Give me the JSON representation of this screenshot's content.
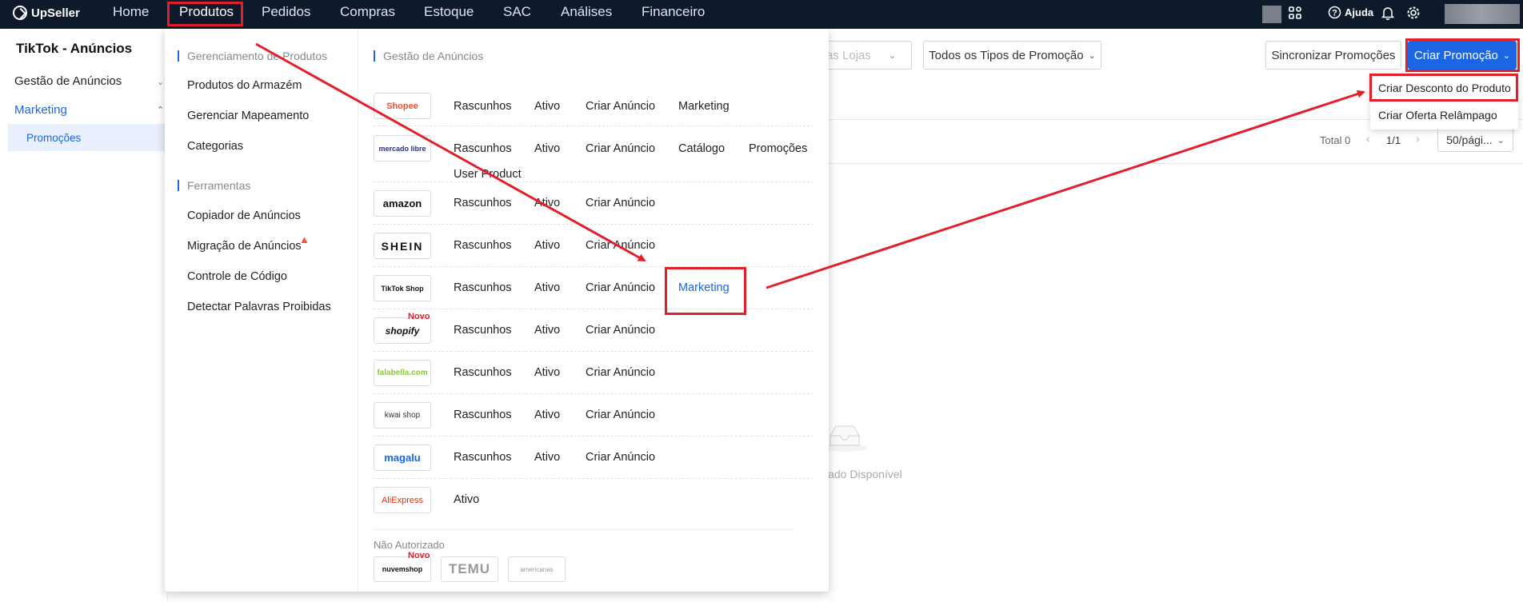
{
  "brand": "UpSeller",
  "nav": [
    "Home",
    "Produtos",
    "Pedidos",
    "Compras",
    "Estoque",
    "SAC",
    "Análises",
    "Financeiro"
  ],
  "topright": {
    "help": "Ajuda"
  },
  "sidebar": {
    "title": "TikTok - Anúncios",
    "items": [
      "Gestão de Anúncios",
      "Marketing"
    ],
    "subitem": "Promoções"
  },
  "filters": {
    "shops_placeholder": "as Lojas",
    "promo_type": "Todos os Tipos de Promoção"
  },
  "actions": {
    "sync": "Sincronizar Promoções",
    "create": "Criar Promoção"
  },
  "create_menu": [
    "Criar Desconto do Produto",
    "Criar Oferta Relâmpago"
  ],
  "pagination": {
    "total": "Total 0",
    "page": "1/1",
    "per_page": "50/pági..."
  },
  "empty_text": "Dado Disponível",
  "mega": {
    "left": {
      "section1": "Gerenciamento de Produtos",
      "items1": [
        "Produtos do Armazém",
        "Gerenciar Mapeamento",
        "Categorias"
      ],
      "section2": "Ferramentas",
      "items2": [
        "Copiador de Anúncios",
        "Migração de Anúncios",
        "Controle de Código",
        "Detectar Palavras Proibidas"
      ]
    },
    "right_title": "Gestão de Anúncios",
    "platforms": [
      {
        "logo": "Shopee",
        "links": [
          "Rascunhos",
          "Ativo",
          "Criar Anúncio",
          "Marketing"
        ]
      },
      {
        "logo": "mercado libre",
        "links": [
          "Rascunhos",
          "Ativo",
          "Criar Anúncio",
          "Catálogo",
          "Promoções"
        ],
        "extra": "User Product"
      },
      {
        "logo": "amazon",
        "links": [
          "Rascunhos",
          "Ativo",
          "Criar Anúncio"
        ]
      },
      {
        "logo": "SHEIN",
        "links": [
          "Rascunhos",
          "Ativo",
          "Criar Anúncio"
        ]
      },
      {
        "logo": "TikTok Shop",
        "links": [
          "Rascunhos",
          "Ativo",
          "Criar Anúncio",
          "Marketing"
        ]
      },
      {
        "logo": "shopify",
        "links": [
          "Rascunhos",
          "Ativo",
          "Criar Anúncio"
        ],
        "badge": "Novo"
      },
      {
        "logo": "falabella.com",
        "links": [
          "Rascunhos",
          "Ativo",
          "Criar Anúncio"
        ]
      },
      {
        "logo": "kwai shop",
        "links": [
          "Rascunhos",
          "Ativo",
          "Criar Anúncio"
        ]
      },
      {
        "logo": "magalu",
        "links": [
          "Rascunhos",
          "Ativo",
          "Criar Anúncio"
        ]
      },
      {
        "logo": "AliExpress",
        "links": [
          "Ativo"
        ]
      }
    ],
    "unauth_title": "Não Autorizado",
    "unauth": [
      {
        "logo": "nuvemshop",
        "badge": "Novo"
      },
      {
        "logo": "TEMU"
      },
      {
        "logo": "americanas"
      }
    ]
  },
  "colors": {
    "topbar": "#0e1a2c",
    "primary": "#1a66e5",
    "highlight": "#e0202b"
  }
}
